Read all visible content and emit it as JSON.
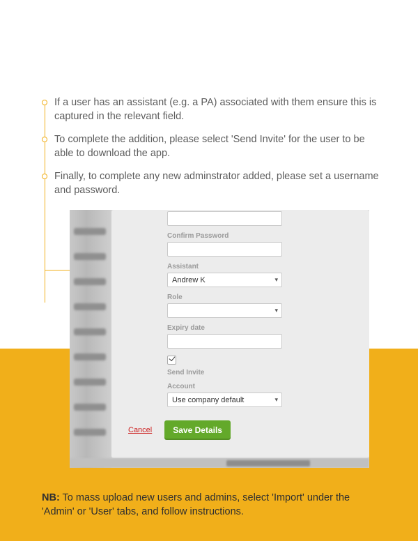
{
  "bullets": [
    "If a user has an assistant (e.g. a PA) associated with them ensure this is captured in the relevant field.",
    "To complete the addition, please select 'Send Invite' for the user to be able to download the app.",
    "Finally, to complete any new adminstrator added, please set a username and password."
  ],
  "form": {
    "confirm_password_label": "Confirm Password",
    "confirm_password_value": "",
    "assistant_label": "Assistant",
    "assistant_value": "Andrew K",
    "role_label": "Role",
    "role_value": "",
    "expiry_label": "Expiry date",
    "expiry_value": "",
    "send_invite_label": "Send Invite",
    "send_invite_checked": true,
    "account_label": "Account",
    "account_value": "Use company default",
    "cancel_label": "Cancel",
    "save_label": "Save Details"
  },
  "nb_prefix": "NB:",
  "nb_text": " To mass upload new users and admins, select 'Import' under the 'Admin' or 'User' tabs, and follow instructions."
}
